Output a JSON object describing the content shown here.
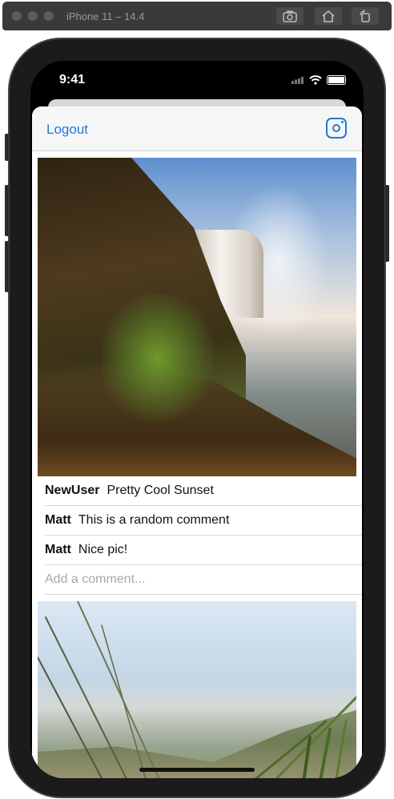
{
  "simulator": {
    "title": "iPhone 11 – 14.4",
    "buttons": [
      "screenshot-icon",
      "home-icon",
      "rotate-icon"
    ]
  },
  "status_bar": {
    "time": "9:41",
    "icons": [
      "signal-icon",
      "wifi-icon",
      "battery-icon"
    ]
  },
  "navbar": {
    "logout_label": "Logout",
    "right_icon": "instagram-icon",
    "accent_color": "#1f7ad8"
  },
  "post": {
    "image": "waterfall-photo",
    "comments": [
      {
        "user": "NewUser",
        "text": "Pretty Cool Sunset"
      },
      {
        "user": "Matt",
        "text": "This is a random comment"
      },
      {
        "user": "Matt",
        "text": "Nice pic!"
      }
    ],
    "comment_placeholder": "Add a comment..."
  },
  "next_post": {
    "image": "beach-grass-photo"
  }
}
